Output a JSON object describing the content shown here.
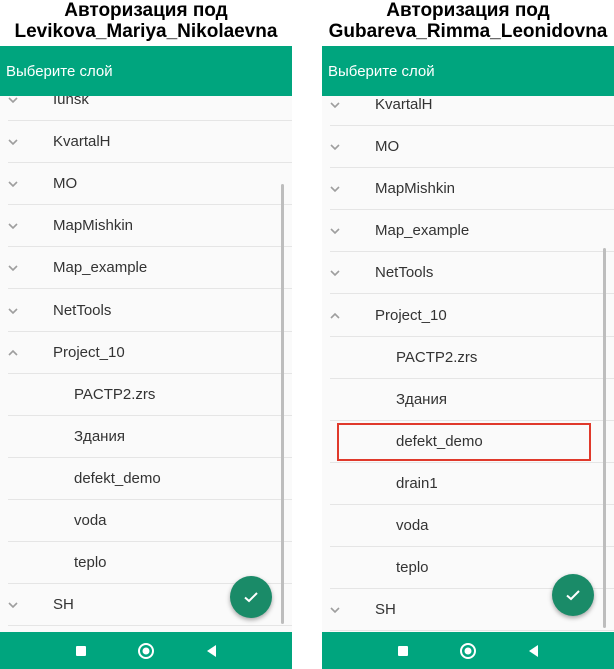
{
  "left": {
    "caption_line1": "Авторизация под",
    "caption_line2": "Levikova_Mariya_Nikolaevna",
    "appbar_title": "Выберите слой",
    "items": [
      {
        "label": "Iunsk",
        "level": 0,
        "expanded": false
      },
      {
        "label": "KvartalH",
        "level": 0,
        "expanded": false
      },
      {
        "label": "MO",
        "level": 0,
        "expanded": false
      },
      {
        "label": "MapMishkin",
        "level": 0,
        "expanded": false
      },
      {
        "label": "Map_example",
        "level": 0,
        "expanded": false
      },
      {
        "label": "NetTools",
        "level": 0,
        "expanded": false
      },
      {
        "label": "Project_10",
        "level": 0,
        "expanded": true
      },
      {
        "label": "PACTP2.zrs",
        "level": 1
      },
      {
        "label": "Здания",
        "level": 1
      },
      {
        "label": "defekt_demo",
        "level": 1
      },
      {
        "label": "voda",
        "level": 1
      },
      {
        "label": "teplo",
        "level": 1
      },
      {
        "label": "SH",
        "level": 0,
        "expanded": false
      }
    ]
  },
  "right": {
    "caption_line1": "Авторизация под",
    "caption_line2": "Gubareva_Rimma_Leonidovna",
    "appbar_title": "Выберите слой",
    "highlighted_item": "defekt_demo",
    "items": [
      {
        "label": "KvartalH",
        "level": 0,
        "expanded": false
      },
      {
        "label": "MO",
        "level": 0,
        "expanded": false
      },
      {
        "label": "MapMishkin",
        "level": 0,
        "expanded": false
      },
      {
        "label": "Map_example",
        "level": 0,
        "expanded": false
      },
      {
        "label": "NetTools",
        "level": 0,
        "expanded": false
      },
      {
        "label": "Project_10",
        "level": 0,
        "expanded": true
      },
      {
        "label": "PACTP2.zrs",
        "level": 1
      },
      {
        "label": "Здания",
        "level": 1
      },
      {
        "label": "defekt_demo",
        "level": 1
      },
      {
        "label": "drain1",
        "level": 1
      },
      {
        "label": "voda",
        "level": 1
      },
      {
        "label": "teplo",
        "level": 1
      },
      {
        "label": "SH",
        "level": 0,
        "expanded": false
      }
    ]
  },
  "colors": {
    "accent": "#00a57e",
    "fab": "#1a8b68",
    "highlight_border": "#e0392b"
  },
  "icons": {
    "collapsed": "chevron-down-icon",
    "expanded": "chevron-up-icon",
    "fab": "check-icon",
    "nav": [
      "square-icon",
      "circle-icon",
      "back-triangle-icon"
    ]
  }
}
